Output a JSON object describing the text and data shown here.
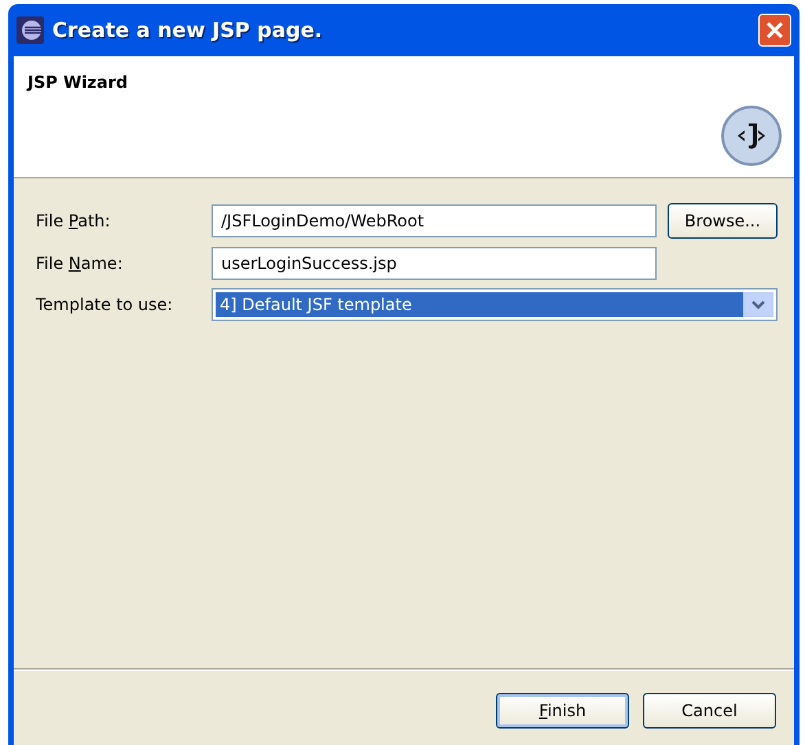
{
  "window": {
    "title": "Create a new JSP page."
  },
  "header": {
    "title": "JSP Wizard"
  },
  "fields": [
    {
      "kind": "text",
      "label": {
        "before": "File ",
        "mnemonic": "P",
        "after": "ath:"
      },
      "value": "/JSFLoginDemo/WebRoot",
      "button": "Browse..."
    },
    {
      "kind": "text",
      "label": {
        "before": "File ",
        "mnemonic": "N",
        "after": "ame:"
      },
      "value": "userLoginSuccess.jsp"
    },
    {
      "kind": "combo",
      "label": {
        "before": "Template to use:"
      },
      "value": "4] Default JSF template",
      "selected": true
    }
  ],
  "buttons": [
    {
      "label": {
        "mnemonic": "F",
        "after": "inish"
      },
      "default": true
    },
    {
      "label": {
        "before": "Cancel"
      },
      "default": false
    }
  ]
}
